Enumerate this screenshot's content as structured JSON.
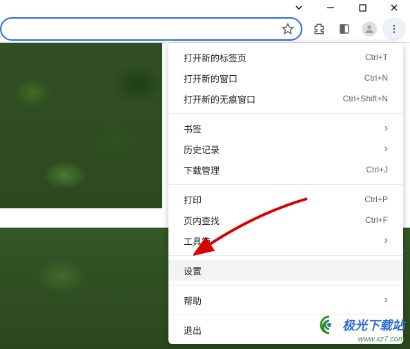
{
  "window_controls": {
    "arrow_down": "⌄",
    "minimize": "—",
    "maximize": "☐",
    "close": "✕"
  },
  "menu": {
    "new_tab": {
      "label": "打开新的标签页",
      "shortcut": "Ctrl+T"
    },
    "new_window": {
      "label": "打开新的窗口",
      "shortcut": "Ctrl+N"
    },
    "new_incognito": {
      "label": "打开新的无痕窗口",
      "shortcut": "Ctrl+Shift+N"
    },
    "bookmarks": {
      "label": "书签"
    },
    "history": {
      "label": "历史记录"
    },
    "downloads": {
      "label": "下载管理",
      "shortcut": "Ctrl+J"
    },
    "print": {
      "label": "打印",
      "shortcut": "Ctrl+P"
    },
    "find": {
      "label": "页内查找",
      "shortcut": "Ctrl+F"
    },
    "toolbox": {
      "label": "工具箱"
    },
    "settings": {
      "label": "设置"
    },
    "help": {
      "label": "帮助"
    },
    "exit": {
      "label": "退出"
    }
  },
  "watermark": {
    "text": "极光下载站",
    "url": "www.xz7.com"
  }
}
